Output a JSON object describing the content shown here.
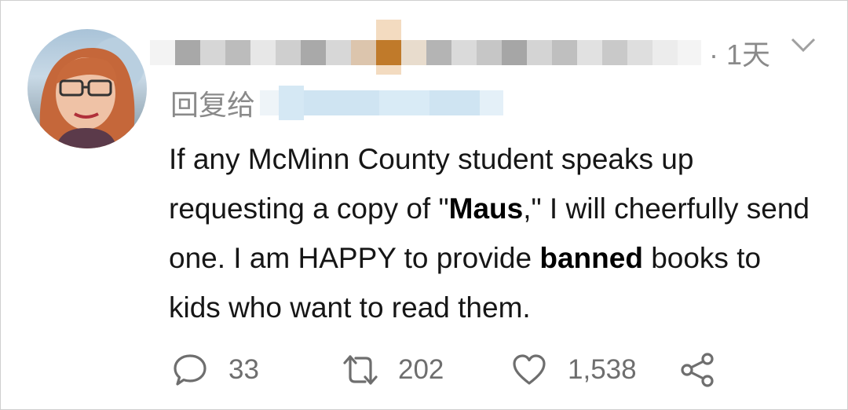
{
  "tweet": {
    "time": "· 1天",
    "reply_prefix": "回复给",
    "body_parts": [
      "If any McMinn County student speaks up requesting a copy of \"",
      "Maus",
      ",\" I will cheerfully send one. I am HAPPY to provide ",
      "banned",
      " books to kids who want to read them."
    ],
    "actions": {
      "reply_count": "33",
      "retweet_count": "202",
      "like_count": "1,538"
    },
    "icons": {
      "reply": "comment-bubble-icon",
      "retweet": "retweet-icon",
      "like": "heart-icon",
      "share": "share-icon",
      "menu": "chevron-down-icon"
    },
    "colors": {
      "meta_gray": "#8a8a8a",
      "count_gray": "#6e6e6e",
      "text": "#161616",
      "redact_blue": "#cfe4f2",
      "redact_orange": "#c07a2a"
    }
  }
}
